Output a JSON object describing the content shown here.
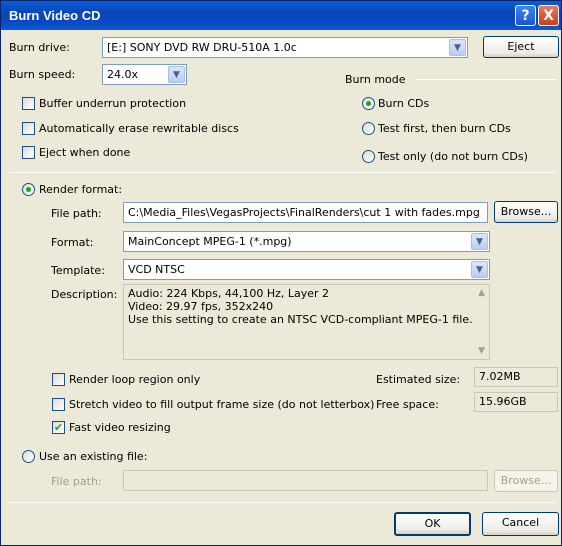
{
  "window": {
    "title": "Burn Video CD"
  },
  "titlebar": {
    "help": "?",
    "close": "X"
  },
  "burn_drive": {
    "label": "Burn drive:",
    "value": "[E:] SONY DVD RW DRU-510A 1.0c",
    "eject": "Eject"
  },
  "burn_speed": {
    "label": "Burn speed:",
    "value": "24.0x"
  },
  "options": {
    "buffer_underrun": "Buffer underrun protection",
    "auto_erase": "Automatically erase rewritable discs",
    "eject_when_done": "Eject when done"
  },
  "burn_mode": {
    "label": "Burn mode",
    "burn_cds": "Burn CDs",
    "test_first": "Test first, then burn CDs",
    "test_only": "Test only (do not burn CDs)"
  },
  "render": {
    "label": "Render format:",
    "file_path_label": "File path:",
    "file_path_value": "C:\\Media_Files\\VegasProjects\\FinalRenders\\cut 1 with fades.mpg",
    "browse": "Browse...",
    "format_label": "Format:",
    "format_value": "MainConcept MPEG-1 (*.mpg)",
    "template_label": "Template:",
    "template_value": "VCD NTSC",
    "description_label": "Description:",
    "description_lines": [
      "Audio: 224 Kbps, 44,100 Hz, Layer 2",
      "Video: 29.97 fps, 352x240",
      "Use this setting to create an NTSC VCD-compliant MPEG-1 file."
    ],
    "loop_region": "Render loop region only",
    "stretch_video": "Stretch video to fill output frame size (do not letterbox)",
    "fast_resize": "Fast video resizing",
    "estimated_size_label": "Estimated size:",
    "estimated_size_value": "7.02MB",
    "free_space_label": "Free space:",
    "free_space_value": "15.96GB"
  },
  "existing": {
    "label": "Use an existing file:",
    "file_path_label": "File path:",
    "file_path_value": "",
    "browse": "Browse..."
  },
  "footer": {
    "ok": "OK",
    "cancel": "Cancel"
  }
}
